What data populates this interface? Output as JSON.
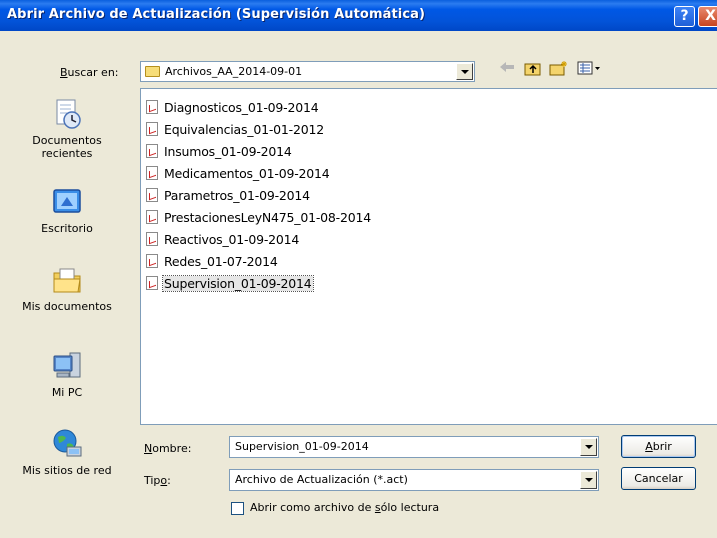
{
  "window": {
    "title": "Abrir Archivo de Actualización (Supervisión Automática)",
    "help_glyph": "?",
    "close_glyph": "X"
  },
  "lookin": {
    "label_underlined": "B",
    "label_rest": "uscar en:",
    "value": "Archivos_AA_2014-09-01"
  },
  "toolbar": {
    "back_icon": "back-arrow-icon",
    "up_icon": "folder-up-icon",
    "new_folder_icon": "new-folder-icon",
    "views_icon": "views-menu-icon"
  },
  "places": [
    {
      "label": "Documentos recientes",
      "icon": "recent-documents-icon"
    },
    {
      "label": "Escritorio",
      "icon": "desktop-icon"
    },
    {
      "label": "Mis documentos",
      "icon": "my-documents-icon"
    },
    {
      "label": "Mi PC",
      "icon": "my-computer-icon"
    },
    {
      "label": "Mis sitios de red",
      "icon": "network-places-icon"
    }
  ],
  "files": [
    "Diagnosticos_01-09-2014",
    "Equivalencias_01-01-2012",
    "Insumos_01-09-2014",
    "Medicamentos_01-09-2014",
    "Parametros_01-09-2014",
    "PrestacionesLeyN475_01-08-2014",
    "Reactivos_01-09-2014",
    "Redes_01-07-2014",
    "Supervision_01-09-2014"
  ],
  "selected_file": "Supervision_01-09-2014",
  "filename": {
    "label_underlined": "N",
    "label_rest": "ombre:",
    "value": "Supervision_01-09-2014"
  },
  "filetype": {
    "label_start": "Tip",
    "label_underlined": "o",
    "label_end": ":",
    "value": "Archivo de Actualización (*.act)"
  },
  "readonly": {
    "label_start": "Abrir como archivo de ",
    "label_underlined": "s",
    "label_end": "ólo lectura",
    "checked": false
  },
  "buttons": {
    "open_underlined": "A",
    "open_rest": "brir",
    "cancel": "Cancelar"
  }
}
